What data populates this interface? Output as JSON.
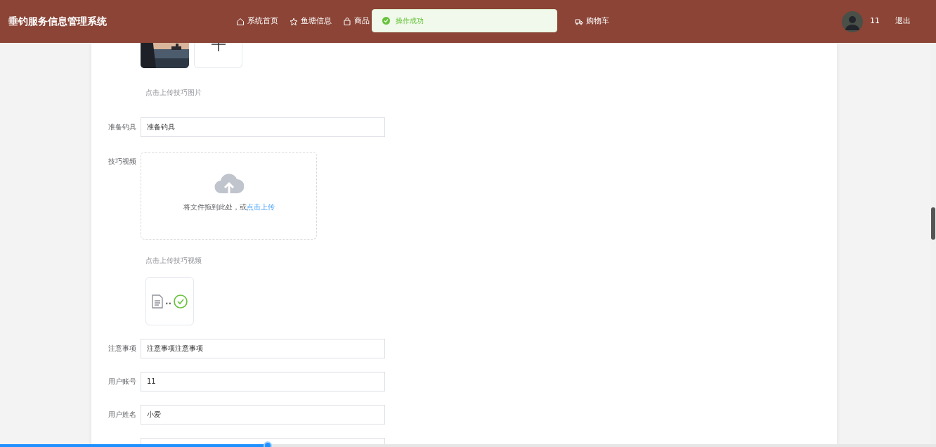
{
  "header": {
    "title": "垂钓服务信息管理系统",
    "nav": [
      {
        "label": "系统首页"
      },
      {
        "label": "鱼塘信息"
      },
      {
        "label": "商品"
      },
      {
        "label": "购物车"
      }
    ],
    "user": {
      "name": "11",
      "logout": "退出"
    }
  },
  "toast": {
    "kind": "success",
    "message": "操作成功"
  },
  "form": {
    "rows": [
      {
        "kind": "images"
      },
      {
        "kind": "hint",
        "text": "点击上传技巧图片"
      },
      {
        "kind": "input",
        "label": "准备钓具",
        "value": "准备钓具"
      },
      {
        "kind": "dropzone",
        "label": "技巧视频",
        "text": "将文件拖到此处，或",
        "link": "点击上传"
      },
      {
        "kind": "hint",
        "text": "点击上传技巧视频"
      },
      {
        "kind": "file",
        "name": "..",
        "uploaded": true
      },
      {
        "kind": "input",
        "label": "注意事项",
        "value": "注意事项注意事项"
      },
      {
        "kind": "input",
        "label": "用户账号",
        "value": "11"
      },
      {
        "kind": "input",
        "label": "用户姓名",
        "value": "小爱"
      },
      {
        "kind": "input"
      }
    ]
  },
  "video_progress": {
    "level": 0.286
  }
}
